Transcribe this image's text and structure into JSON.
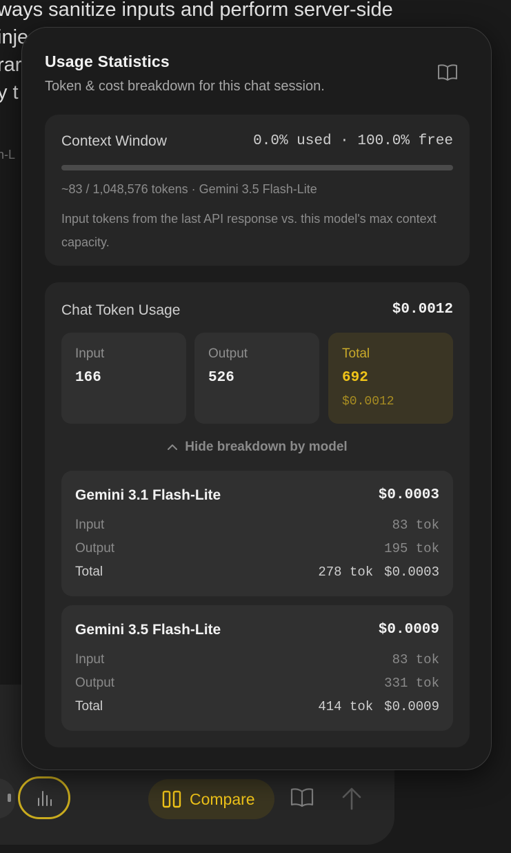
{
  "background": {
    "lines": [
      "ways sanitize inputs and perform server-side",
      "inje",
      "rar",
      "y t"
    ],
    "caption": "n-L"
  },
  "popover": {
    "title": "Usage Statistics",
    "subtitle": "Token & cost breakdown for this chat session.",
    "context": {
      "label": "Context Window",
      "percent_text": "0.0% used · 100.0% free",
      "used_fraction": 0.0,
      "tokens_text": "~83 / 1,048,576 tokens · Gemini 3.5 Flash-Lite",
      "description": "Input tokens from the last API response vs. this model's max context capacity."
    },
    "usage": {
      "label": "Chat Token Usage",
      "cost": "$0.0012",
      "input": {
        "label": "Input",
        "value": "166"
      },
      "output": {
        "label": "Output",
        "value": "526"
      },
      "total": {
        "label": "Total",
        "value": "692",
        "cost": "$0.0012"
      },
      "toggle_label": "Hide breakdown by model",
      "models": [
        {
          "name": "Gemini 3.1 Flash-Lite",
          "cost": "$0.0003",
          "input_label": "Input",
          "input": "83 tok",
          "output_label": "Output",
          "output": "195 tok",
          "total_label": "Total",
          "total_tokens": "278 tok",
          "total_cost": "$0.0003"
        },
        {
          "name": "Gemini 3.5 Flash-Lite",
          "cost": "$0.0009",
          "input_label": "Input",
          "input": "83 tok",
          "output_label": "Output",
          "output": "331 tok",
          "total_label": "Total",
          "total_tokens": "414 tok",
          "total_cost": "$0.0009"
        }
      ]
    }
  },
  "composer": {
    "compare_label": "Compare"
  },
  "colors": {
    "accent": "#f0c419",
    "panel": "#1c1c1c",
    "card": "#262626"
  },
  "icons": [
    "book-open-icon",
    "bar-chart-icon",
    "columns-icon",
    "arrow-up-icon",
    "chevron-up-icon"
  ]
}
